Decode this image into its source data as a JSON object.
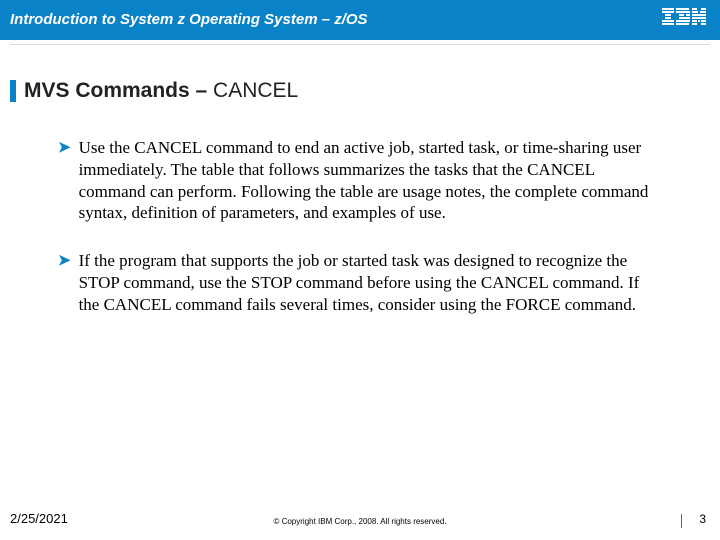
{
  "header": {
    "title": "Introduction to System z Operating System – z/OS",
    "logo_name": "ibm-logo"
  },
  "title": {
    "bold": "MVS Commands – ",
    "light": "CANCEL"
  },
  "bullets": [
    "Use the CANCEL command to end an active job, started task, or time-sharing user immediately. The table that follows summarizes the tasks that the CANCEL command can perform. Following the table are usage notes, the complete command syntax, definition of parameters, and examples of use.",
    "If the program that supports the job or started task was designed to recognize the STOP command, use the STOP command before using the CANCEL command. If the CANCEL command fails several times, consider using the FORCE command."
  ],
  "footer": {
    "date": "2/25/2021",
    "copyright": "© Copyright IBM Corp., 2008. All rights reserved.",
    "page": "3"
  }
}
